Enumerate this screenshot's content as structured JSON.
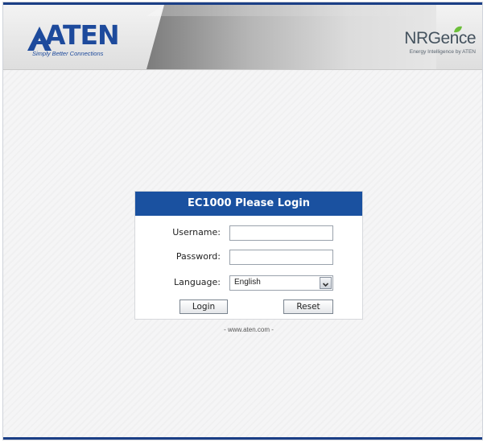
{
  "header": {
    "brand_name": "ATEN",
    "brand_tagline": "Simply Better Connections",
    "product_brand": "NRGence",
    "product_tagline": "Energy Intelligence by ATEN"
  },
  "login": {
    "title": "EC1000 Please Login",
    "username_label": "Username:",
    "username_value": "",
    "password_label": "Password:",
    "password_value": "",
    "language_label": "Language:",
    "language_selected": "English",
    "login_button": "Login",
    "reset_button": "Reset"
  },
  "footer": {
    "link_text": "- www.aten.com -"
  },
  "colors": {
    "brand_blue": "#1d4a9c",
    "title_bar": "#1a51a0",
    "leaf_green": "#6cbf3a"
  }
}
